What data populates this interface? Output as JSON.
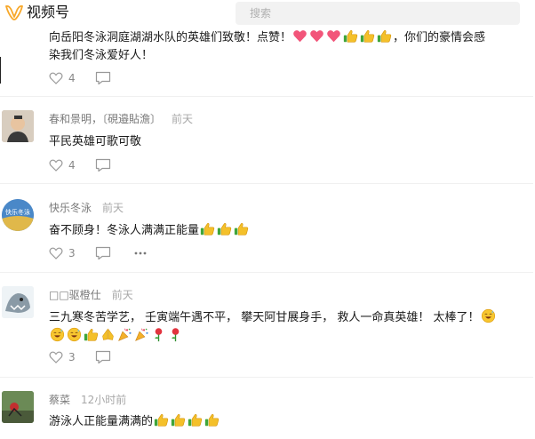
{
  "app": {
    "title": "视频号",
    "search_placeholder": "搜索"
  },
  "comments": [
    {
      "name": "",
      "time": "",
      "text_a": "向岳阳冬泳洞庭湖湖水队的英雄们致敬！点赞！",
      "text_b": "，你们的豪情会感",
      "text_c": "染我们冬泳爱好人！",
      "likes": "4"
    },
    {
      "name": "春和景明，〔硯邉貼澹〕",
      "time": "前天",
      "text": "平民英雄可歌可敬",
      "likes": "4"
    },
    {
      "name": "快乐冬泳",
      "time": "前天",
      "text": "奋不顾身！冬泳人满满正能量",
      "likes": "3",
      "avatar_text": "快乐冬泳"
    },
    {
      "name": "□□驱橙仕",
      "time": "前天",
      "text_a": "三九寒冬苦学艺，  壬寅端午遇不平，  攀天阿甘展身手，  救人一命真英雄！  太棒了！",
      "likes": "3"
    },
    {
      "name": "蔡菜",
      "time": "12小时前",
      "text": "游泳人正能量满满的"
    }
  ],
  "colors": {
    "accent": "#f7a82b",
    "heart": "#f2557a",
    "thumb": "#f4c02a",
    "text_main": "#1a1a1a",
    "text_muted": "#888888"
  },
  "icons": [
    "logo-icon",
    "heart-icon",
    "comment-icon",
    "more-icon",
    "thumbs-up-icon",
    "pray-icon",
    "party-popper-icon",
    "rose-icon",
    "grin-sweat-icon"
  ]
}
